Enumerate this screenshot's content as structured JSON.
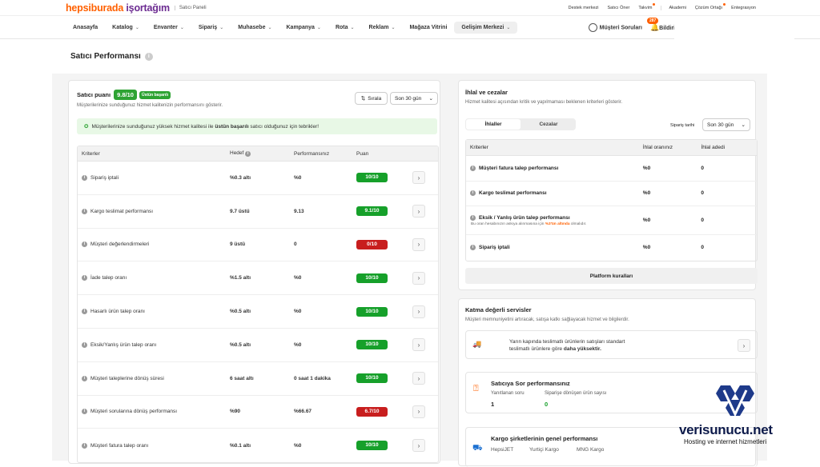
{
  "topbar": {
    "logo_a": "hepsiburada",
    "logo_b": "iş",
    "logo_c": "ortağım",
    "panel": "Satıcı Paneli",
    "links": [
      "Destek merkezi",
      "Satıcı Öner",
      "Takvim",
      "Akademi",
      "Çözüm Ortağı",
      "Entegrasyon"
    ]
  },
  "nav": {
    "items": [
      {
        "label": "Anasayfa",
        "chev": false
      },
      {
        "label": "Katalog",
        "chev": true
      },
      {
        "label": "Envanter",
        "chev": true
      },
      {
        "label": "Sipariş",
        "chev": true
      },
      {
        "label": "Muhasebe",
        "chev": true
      },
      {
        "label": "Kampanya",
        "chev": true
      },
      {
        "label": "Rota",
        "chev": true
      },
      {
        "label": "Reklam",
        "chev": true
      },
      {
        "label": "Mağaza Vitrini",
        "chev": false
      },
      {
        "label": "Gelişim Merkezi",
        "chev": true
      }
    ],
    "questions": "Müşteri Soruları",
    "notif_count": "287",
    "notif": "Bildiri"
  },
  "page": {
    "title": "Satıcı Performansı"
  },
  "score_card": {
    "title": "Satıcı puanı",
    "score": "9.8/10",
    "badge": "Üstün başarılı",
    "subtitle": "Müşterilerinize sunduğunuz hizmet kalitenizin performansını gösterir.",
    "sort": "Sırala",
    "period": "Son 30 gün",
    "banner_a": "Müşterilerinize sunduğunuz yüksek hizmet kalitesi ile ",
    "banner_b": "üstün başarılı",
    "banner_c": " satıcı olduğunuz için tebrikler!",
    "headers": [
      "Kriterler",
      "Hedef",
      "Performansınız",
      "Puan"
    ],
    "rows": [
      {
        "name": "Sipariş iptali",
        "target": "%0.3 altı",
        "perf": "%0",
        "score": "10/10",
        "status": "good"
      },
      {
        "name": "Kargo teslimat performansı",
        "target": "9.7 üstü",
        "perf": "9.13",
        "score": "9.1/10",
        "status": "good"
      },
      {
        "name": "Müşteri değerlendirmeleri",
        "target": "9 üstü",
        "perf": "0",
        "score": "0/10",
        "status": "bad"
      },
      {
        "name": "İade talep oranı",
        "target": "%1.5 altı",
        "perf": "%0",
        "score": "10/10",
        "status": "good"
      },
      {
        "name": "Hasarlı ürün talep oranı",
        "target": "%0.5 altı",
        "perf": "%0",
        "score": "10/10",
        "status": "good"
      },
      {
        "name": "Eksik/Yanlış ürün talep oranı",
        "target": "%0.5 altı",
        "perf": "%0",
        "score": "10/10",
        "status": "good"
      },
      {
        "name": "Müşteri taleplerine dönüş süresi",
        "target": "6 saat altı",
        "perf": "0 saat 1 dakika",
        "score": "10/10",
        "status": "good"
      },
      {
        "name": "Müşteri sorularına dönüş performansı",
        "target": "%90",
        "perf": "%66.67",
        "score": "6.7/10",
        "status": "bad"
      },
      {
        "name": "Müşteri fatura talep oranı",
        "target": "%0.1 altı",
        "perf": "%0",
        "score": "10/10",
        "status": "good"
      }
    ]
  },
  "penalty_card": {
    "title": "İhlal ve cezalar",
    "subtitle": "Hizmet kalitesi açısından kritik ve yapılmaması beklenen kriterleri gösterir.",
    "tab_active": "İhlaller",
    "tab_other": "Cezalar",
    "date_label": "Sipariş tarihi",
    "period": "Son 30 gün",
    "headers": [
      "Kriterler",
      "İhlal oranınız",
      "İhlal adedi"
    ],
    "rows": [
      {
        "name": "Müşteri fatura talep performansı",
        "rate": "%0",
        "count": "0"
      },
      {
        "name": "Kargo teslimat performansı",
        "rate": "%0",
        "count": "0"
      },
      {
        "name": "Eksik / Yanlış ürün talep performansı",
        "rate": "%0",
        "count": "0",
        "note_a": "Bu oran hesabınızın askıya alınmasına için ",
        "note_b": "%3'ün altında",
        "note_c": " olmalıdır."
      },
      {
        "name": "Sipariş iptali",
        "rate": "%0",
        "count": "0"
      }
    ],
    "platform_btn": "Platform kuralları"
  },
  "services_card": {
    "title": "Katma değerli servisler",
    "subtitle": "Müşteri memnuniyetini artıracak, satışa katkı sağlayacak hizmet ve bilgilerdir.",
    "promo_a": "Yarın kapında teslimatlı ürünlerin satışları standart",
    "promo_b": "teslimatlı ürünlere göre ",
    "promo_c": "daha yüksektir.",
    "qa_title": "Satıcıya Sor performansınız",
    "qa_labels": [
      "Yanıtlanan soru",
      "Siparişe dönüşen ürün sayısı"
    ],
    "qa_values": [
      "1",
      "0"
    ],
    "cargo_title": "Kargo şirketlerinin genel performansı",
    "cargo_names": [
      "HepsiJET",
      "Yurtiçi Kargo",
      "MNG Kargo"
    ]
  },
  "watermark": {
    "name": "verisunucu.net",
    "tagline": "Hosting ve internet hizmetleri"
  },
  "colors": {
    "brand_orange": "#ff6000",
    "brand_purple": "#6c2b91",
    "good": "#16a02a",
    "bad": "#c81e1e"
  }
}
